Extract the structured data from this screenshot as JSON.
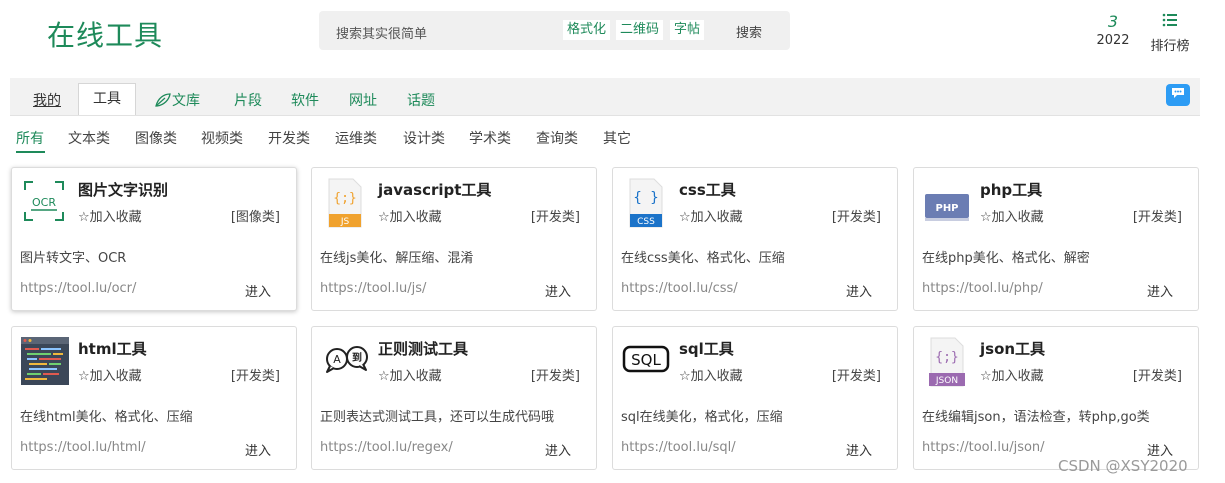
{
  "header": {
    "logo": "在线工具",
    "search": {
      "placeholder": "搜索其实很简单",
      "quick_links": [
        "格式化",
        "二维码",
        "字帖"
      ],
      "button": "搜索"
    },
    "count": {
      "num": "3",
      "year": "2022"
    },
    "rank": {
      "label": "排行榜"
    }
  },
  "nav": {
    "mine": "我的",
    "tabs": [
      "工具",
      "文库",
      "片段",
      "软件",
      "网址",
      "话题"
    ]
  },
  "categories": [
    "所有",
    "文本类",
    "图像类",
    "视频类",
    "开发类",
    "运维类",
    "设计类",
    "学术类",
    "查询类",
    "其它"
  ],
  "cards": [
    {
      "title": "图片文字识别",
      "fav": "加入收藏",
      "type": "[图像类]",
      "desc": "图片转文字、OCR",
      "url": "https://tool.lu/ocr/",
      "enter": "进入",
      "icon_text": "OCR"
    },
    {
      "title": "javascript工具",
      "fav": "加入收藏",
      "type": "[开发类]",
      "desc": "在线js美化、解压缩、混淆",
      "url": "https://tool.lu/js/",
      "enter": "进入",
      "icon_text": "JS"
    },
    {
      "title": "css工具",
      "fav": "加入收藏",
      "type": "[开发类]",
      "desc": "在线css美化、格式化、压缩",
      "url": "https://tool.lu/css/",
      "enter": "进入",
      "icon_text": "CSS"
    },
    {
      "title": "php工具",
      "fav": "加入收藏",
      "type": "[开发类]",
      "desc": "在线php美化、格式化、解密",
      "url": "https://tool.lu/php/",
      "enter": "进入",
      "icon_text": "PHP"
    },
    {
      "title": "html工具",
      "fav": "加入收藏",
      "type": "[开发类]",
      "desc": "在线html美化、格式化、压缩",
      "url": "https://tool.lu/html/",
      "enter": "进入",
      "icon_text": ""
    },
    {
      "title": "正则测试工具",
      "fav": "加入收藏",
      "type": "[开发类]",
      "desc": "正则表达式测试工具，还可以生成代码哦",
      "url": "https://tool.lu/regex/",
      "enter": "进入",
      "icon_text": "A 到"
    },
    {
      "title": "sql工具",
      "fav": "加入收藏",
      "type": "[开发类]",
      "desc": "sql在线美化，格式化，压缩",
      "url": "https://tool.lu/sql/",
      "enter": "进入",
      "icon_text": "SQL"
    },
    {
      "title": "json工具",
      "fav": "加入收藏",
      "type": "[开发类]",
      "desc": "在线编辑json，语法检查，转php,go类",
      "url": "https://tool.lu/json/",
      "enter": "进入",
      "icon_text": "JSON"
    }
  ],
  "watermark": "CSDN @XSY2020",
  "colors": {
    "brand": "#1e8a5a",
    "chat": "#2d9cf4",
    "js": "#f0a22e",
    "css": "#1b73c9",
    "php": "#6b7db3",
    "json": "#9b6ab0"
  }
}
